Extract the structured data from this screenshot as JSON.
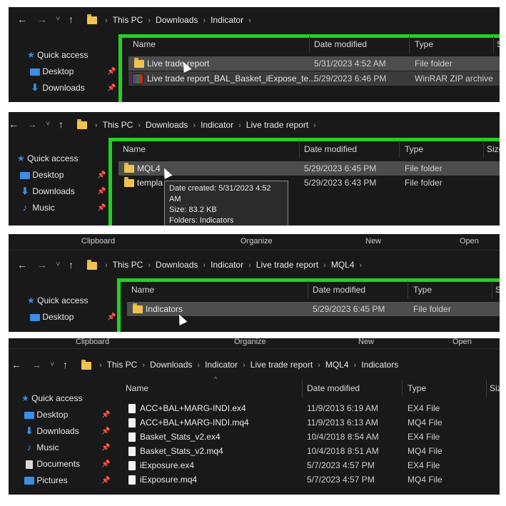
{
  "nav": {
    "back": "←",
    "forward": "→",
    "recent": "˅",
    "up": "↑",
    "sep": "›"
  },
  "sidebar": {
    "quick_access": "Quick access",
    "desktop": "Desktop",
    "downloads": "Downloads",
    "music": "Music",
    "documents": "Documents",
    "pictures": "Pictures",
    "pin": "📌"
  },
  "columns": {
    "name": "Name",
    "date_modified": "Date modified",
    "type": "Type",
    "size": "Size",
    "size_clipped": "S"
  },
  "ribbon": {
    "clipboard": "Clipboard",
    "organize": "Organize",
    "new": "New",
    "open": "Open"
  },
  "panel1": {
    "breadcrumbs": [
      "This PC",
      "Downloads",
      "Indicator"
    ],
    "files": [
      {
        "name": "Live trade report",
        "date": "5/31/2023 4:52 AM",
        "type": "File folder"
      },
      {
        "name": "Live trade report_BAL_Basket_iExpose_te...",
        "date": "5/29/2023 6:46 PM",
        "type": "WinRAR ZIP archive"
      }
    ]
  },
  "panel2": {
    "breadcrumbs": [
      "This PC",
      "Downloads",
      "Indicator",
      "Live trade report"
    ],
    "files": [
      {
        "name": "MQL4",
        "date": "5/29/2023 6:45 PM",
        "type": "File folder"
      },
      {
        "name": "templa",
        "date": "5/29/2023 6:43 PM",
        "type": "File folder"
      }
    ],
    "tooltip": {
      "created": "Date created: 5/31/2023 4:52 AM",
      "size": "Size: 83.2 KB",
      "folders": "Folders: Indicators"
    }
  },
  "panel3": {
    "breadcrumbs": [
      "This PC",
      "Downloads",
      "Indicator",
      "Live trade report",
      "MQL4"
    ],
    "files": [
      {
        "name": "Indicators",
        "date": "5/29/2023 6:45 PM",
        "type": "File folder"
      }
    ]
  },
  "panel4": {
    "breadcrumbs": [
      "This PC",
      "Downloads",
      "Indicator",
      "Live trade report",
      "MQL4",
      "Indicators"
    ],
    "files": [
      {
        "name": "ACC+BAL+MARG-INDI.ex4",
        "date": "11/9/2013 6:19 AM",
        "type": "EX4 File"
      },
      {
        "name": "ACC+BAL+MARG-INDI.mq4",
        "date": "11/9/2013 6:13 AM",
        "type": "MQ4 File"
      },
      {
        "name": "Basket_Stats_v2.ex4",
        "date": "10/4/2018 8:54 AM",
        "type": "EX4 File"
      },
      {
        "name": "Basket_Stats_v2.mq4",
        "date": "10/4/2018 8:51 AM",
        "type": "MQ4 File"
      },
      {
        "name": "iExposure.ex4",
        "date": "5/7/2023 4:57 PM",
        "type": "EX4 File"
      },
      {
        "name": "iExposure.mq4",
        "date": "5/7/2023 4:57 PM",
        "type": "MQ4 File"
      }
    ]
  }
}
